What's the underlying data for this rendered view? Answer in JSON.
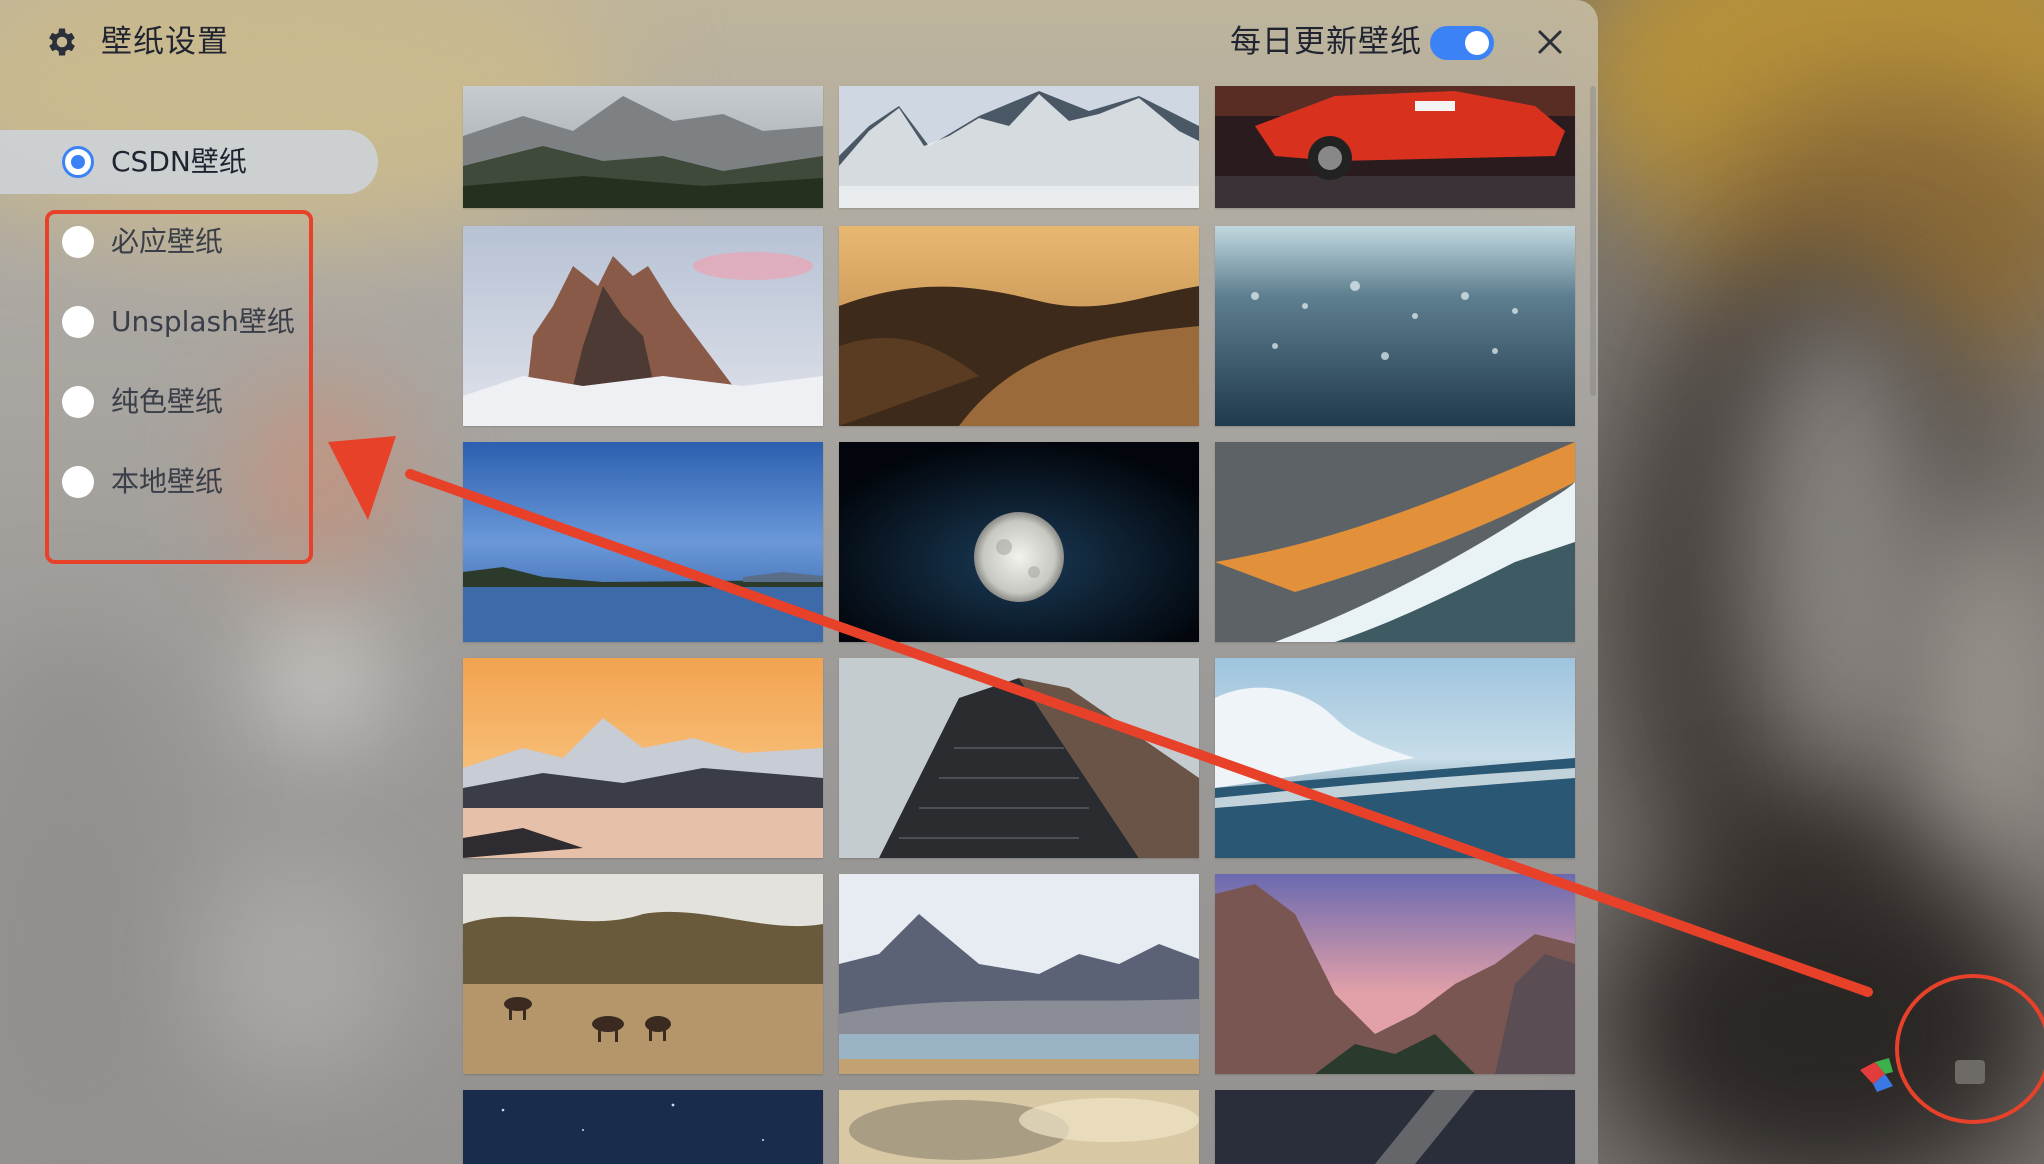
{
  "header": {
    "title": "壁纸设置",
    "daily_update_label": "每日更新壁纸",
    "daily_update_enabled": true
  },
  "sidebar": {
    "items": [
      {
        "label": "CSDN壁纸",
        "selected": true
      },
      {
        "label": "必应壁纸",
        "selected": false
      },
      {
        "label": "Unsplash壁纸",
        "selected": false
      },
      {
        "label": "纯色壁纸",
        "selected": false
      },
      {
        "label": "本地壁纸",
        "selected": false
      }
    ]
  },
  "wallpapers": [
    {
      "name": "rocky-mountain-peaks"
    },
    {
      "name": "snowy-mountains"
    },
    {
      "name": "red-sports-car"
    },
    {
      "name": "dolomite-peaks"
    },
    {
      "name": "desert-dunes"
    },
    {
      "name": "ocean-water-closeup"
    },
    {
      "name": "blue-lake"
    },
    {
      "name": "full-moon"
    },
    {
      "name": "golden-wave"
    },
    {
      "name": "orange-sky-mountain"
    },
    {
      "name": "skyscraper-upward"
    },
    {
      "name": "big-wave-surfer"
    },
    {
      "name": "horses-in-field"
    },
    {
      "name": "volcano-and-lake"
    },
    {
      "name": "granite-cliffs-sunset"
    },
    {
      "name": "night-starry-sky"
    },
    {
      "name": "cloudy-sky"
    },
    {
      "name": "milky-way"
    }
  ],
  "colors": {
    "accent": "#3b82f6",
    "annotation": "#e8412a"
  }
}
